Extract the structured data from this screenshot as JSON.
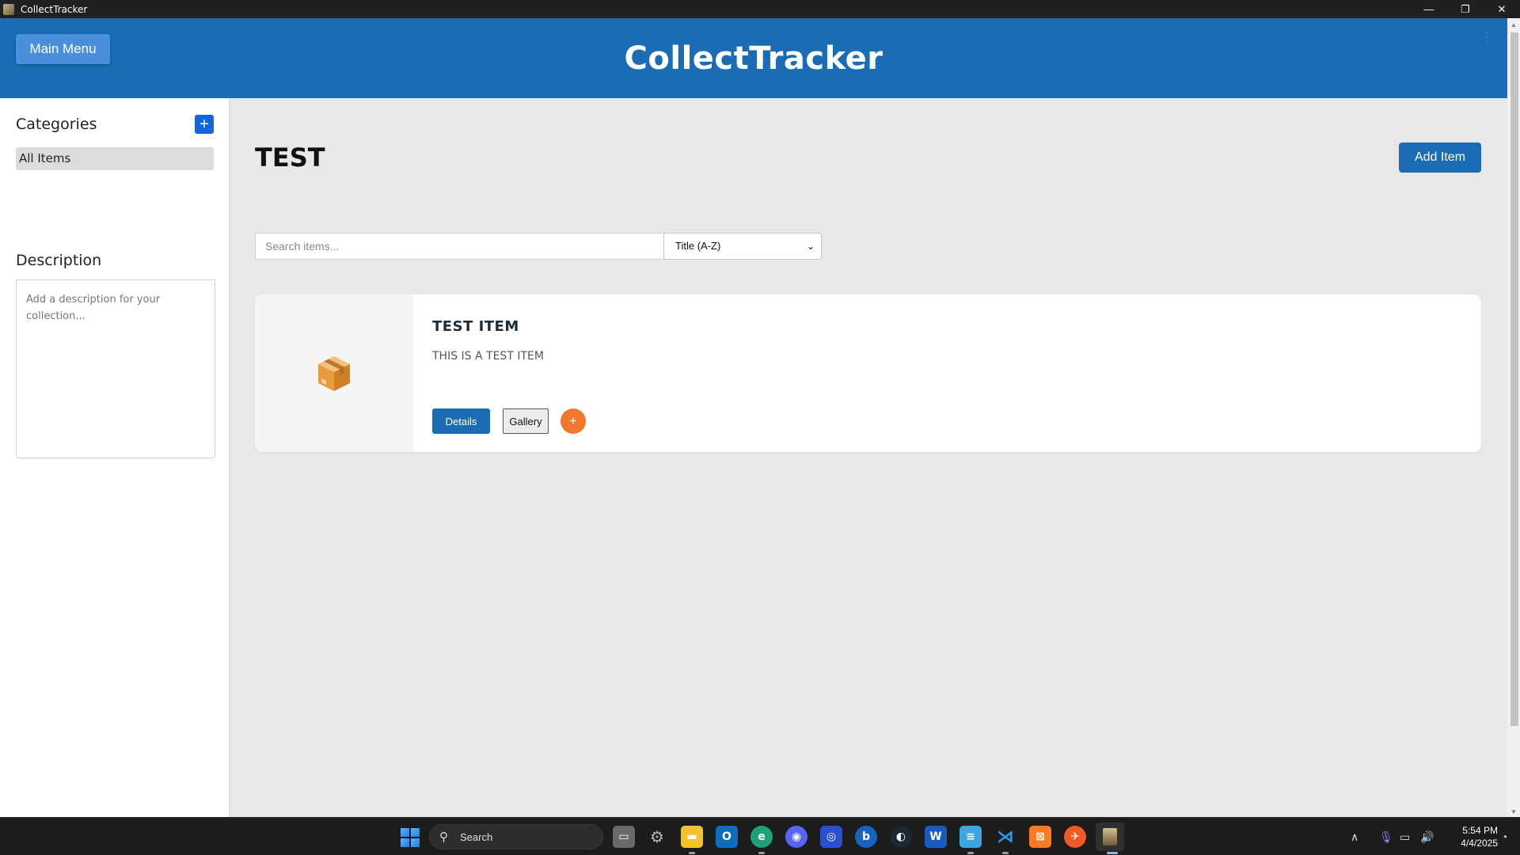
{
  "window": {
    "title": "CollectTracker",
    "controls": {
      "minimize": "—",
      "restore": "❐",
      "close": "✕"
    }
  },
  "header": {
    "main_menu_label": "Main Menu",
    "app_title": "CollectTracker"
  },
  "sidebar": {
    "categories_heading": "Categories",
    "add_category_label": "+",
    "categories": [
      {
        "label": "All Items",
        "selected": true
      }
    ],
    "description_heading": "Description",
    "description_placeholder": "Add a description for your collection..."
  },
  "main": {
    "page_title": "TEST",
    "add_item_label": "Add Item",
    "search_placeholder": "Search items...",
    "sort_selected": "Title (A-Z)",
    "items": [
      {
        "title": "TEST ITEM",
        "description": "THIS IS A TEST ITEM",
        "thumbnail_icon": "package-icon",
        "details_label": "Details",
        "gallery_label": "Gallery",
        "add_label": "+"
      }
    ]
  },
  "taskbar": {
    "search_label": "Search",
    "apps": [
      "task-view-icon",
      "settings-icon",
      "file-explorer-icon",
      "outlook-icon",
      "edge-icon",
      "discord-icon",
      "app-icon",
      "bing-icon",
      "steam-icon",
      "word-icon",
      "notepad-icon",
      "vscode-icon",
      "xampp-icon",
      "postman-icon",
      "collecttracker-icon"
    ],
    "time": "5:54 PM",
    "date": "4/4/2025"
  },
  "colors": {
    "header_blue": "#1a6db5",
    "main_menu_blue": "#4a8fdb",
    "accent_orange": "#f2772b",
    "add_category_blue": "#1565d8"
  }
}
